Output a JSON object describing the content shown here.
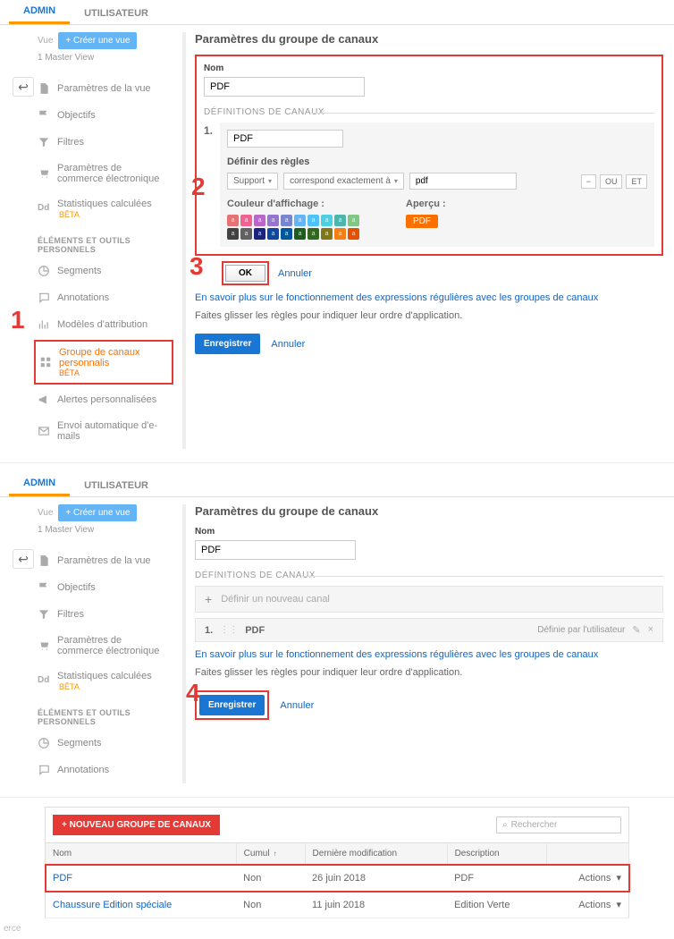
{
  "tabs": {
    "admin": "ADMIN",
    "user": "UTILISATEUR"
  },
  "vue": {
    "label": "Vue",
    "create": "+  Créer une vue",
    "master": "1 Master View"
  },
  "back_arrow": "↩",
  "menu": {
    "settings": "Paramètres de la vue",
    "objectives": "Objectifs",
    "filters": "Filtres",
    "ecom": "Paramètres de commerce électronique",
    "calc": "Statistiques calculées",
    "beta": "BÊTA",
    "section_personal": "ÉLÉMENTS ET OUTILS PERSONNELS",
    "segments": "Segments",
    "annotations": "Annotations",
    "models": "Modèles d'attribution",
    "channel_group": "Groupe de canaux personnalis",
    "channel_group_sub": "BÊTA",
    "alerts": "Alertes personnalisées",
    "email": "Envoi automatique d'e-mails"
  },
  "panel": {
    "title": "Paramètres du groupe de canaux",
    "name_label": "Nom",
    "name_value": "PDF",
    "def_header": "DÉFINITIONS DE CANAUX",
    "rule_num": "1.",
    "rule_name": "PDF",
    "rule_title": "Définir des règles",
    "dim": "Support",
    "match": "correspond exactement à",
    "val": "pdf",
    "op_minus": "−",
    "op_or": "OU",
    "op_and": "ET",
    "color_label": "Couleur d'affichage :",
    "preview_label": "Aperçu :",
    "preview_value": "PDF",
    "ok": "OK",
    "cancel": "Annuler",
    "info_link": "En savoir plus sur le fonctionnement des expressions régulières avec les groupes de canaux",
    "info_drag": "Faites glisser les règles pour indiquer leur ordre d'application.",
    "save": "Enregistrer",
    "new_channel_placeholder": "Définir un nouveau canal",
    "channel_defined": "Définie par l'utilisateur"
  },
  "colors": [
    "#e57373",
    "#f06292",
    "#ba68c8",
    "#9575cd",
    "#7986cb",
    "#64b5f6",
    "#4fc3f7",
    "#4dd0e1",
    "#4db6ac",
    "#81c784",
    "#424242",
    "#616161",
    "#1a237e",
    "#0d47a1",
    "#01579b",
    "#1b5e20",
    "#33691e",
    "#827717",
    "#f57f17",
    "#e65100"
  ],
  "numbers": {
    "n1": "1",
    "n2": "2",
    "n3": "3",
    "n4": "4"
  },
  "table": {
    "new_btn": "+ NOUVEAU GROUPE DE CANAUX",
    "search_placeholder": "Rechercher",
    "cols": {
      "name": "Nom",
      "cumul": "Cumul",
      "modified": "Dernière modification",
      "desc": "Description",
      "actions": "Actions"
    },
    "rows": [
      {
        "name": "PDF",
        "cumul": "Non",
        "modified": "26 juin 2018",
        "desc": "PDF"
      },
      {
        "name": "Chaussure Edition spéciale",
        "cumul": "Non",
        "modified": "11 juin 2018",
        "desc": "Edition Verte"
      }
    ]
  },
  "erce": "erce"
}
